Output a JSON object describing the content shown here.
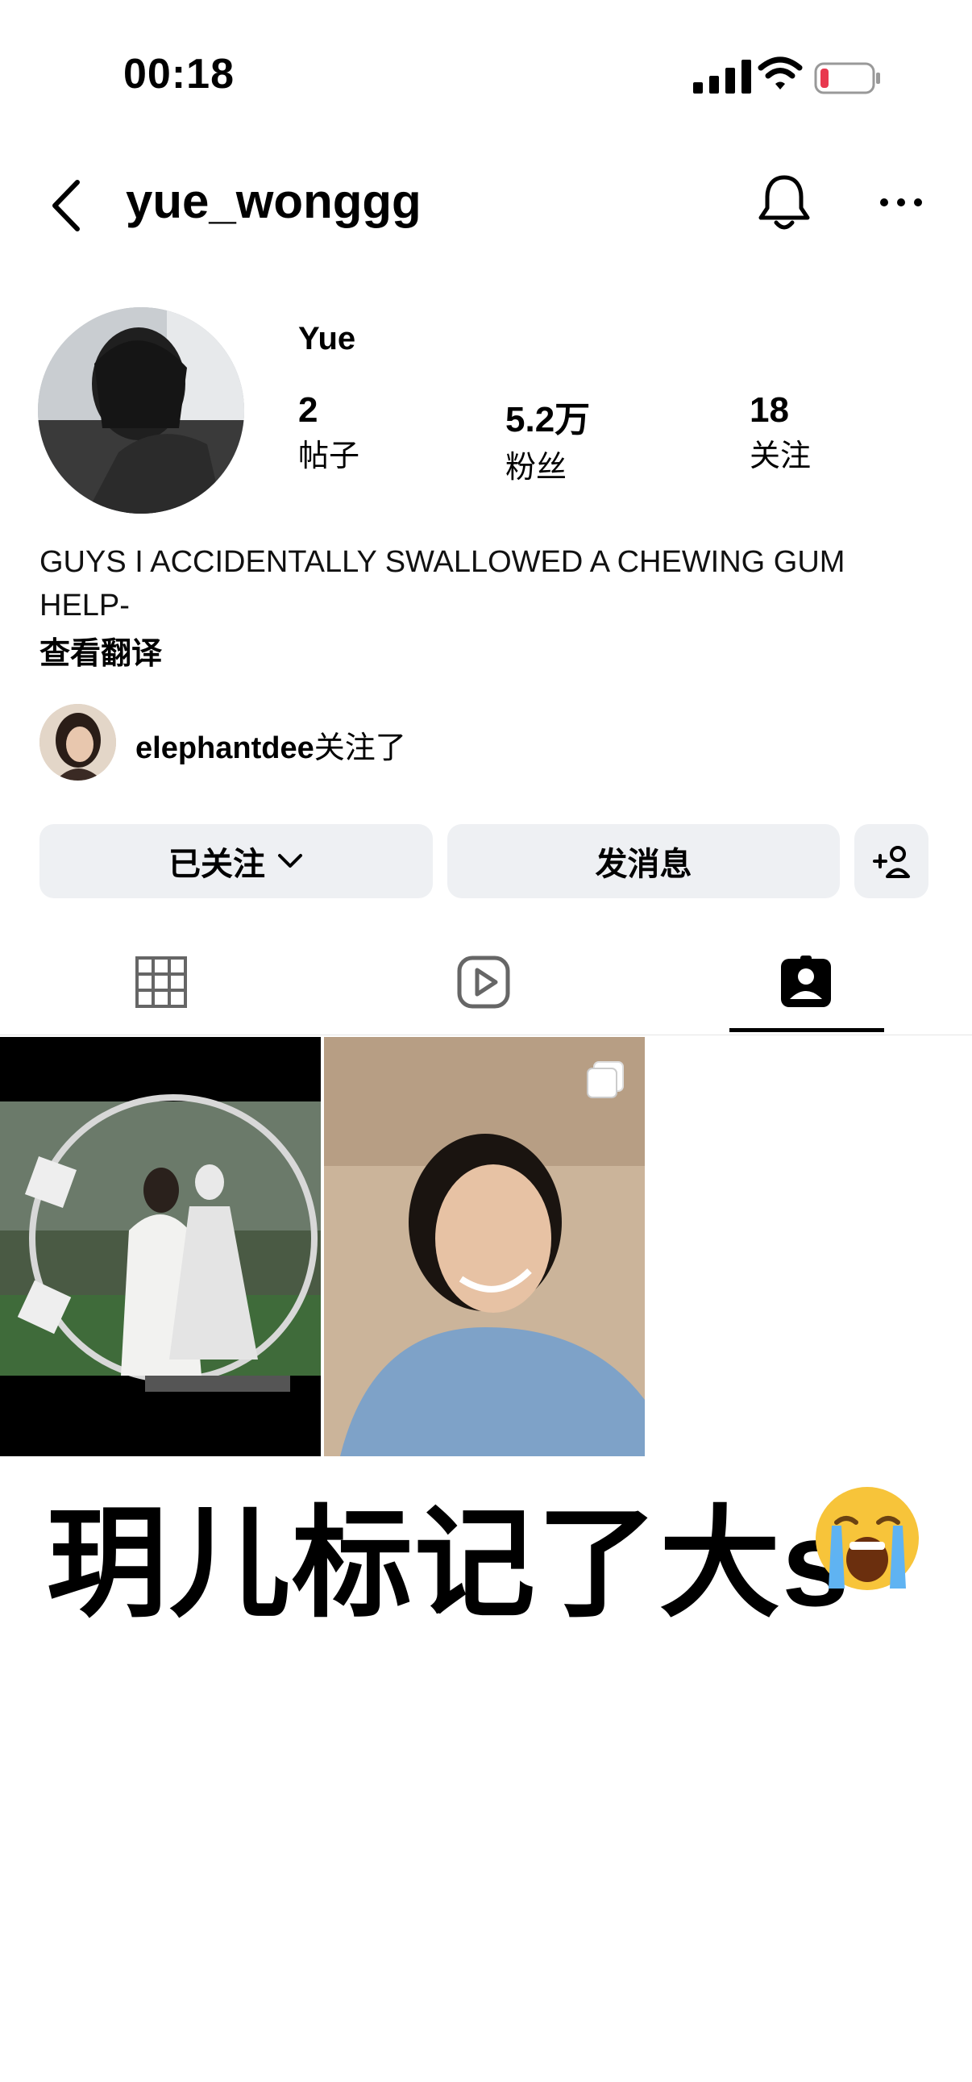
{
  "status_bar": {
    "time": "00:18",
    "battery_color": "#e8384f"
  },
  "header": {
    "username": "yue_wonggg"
  },
  "profile": {
    "display_name": "Yue",
    "stats": [
      {
        "value": "2",
        "label": "帖子"
      },
      {
        "value": "5.2万",
        "label": "粉丝"
      },
      {
        "value": "18",
        "label": "关注"
      }
    ],
    "bio": "GUYS I ACCIDENTALLY SWALLOWED A CHEWING GUM HELP-",
    "translate_link": "查看翻译",
    "followed_by_user": "elephantdee",
    "followed_by_suffix": "关注了"
  },
  "buttons": {
    "following_label": "已关注",
    "message_label": "发消息"
  },
  "tabs": [
    {
      "icon": "grid-icon"
    },
    {
      "icon": "reels-icon"
    },
    {
      "icon": "tagged-icon",
      "active": true
    }
  ],
  "grid_posts": [
    {
      "description_icon": "photo"
    },
    {
      "description_icon": "carousel"
    }
  ],
  "caption": "玥儿标记了大s",
  "caption_emoji": "loudly-crying-face-icon"
}
